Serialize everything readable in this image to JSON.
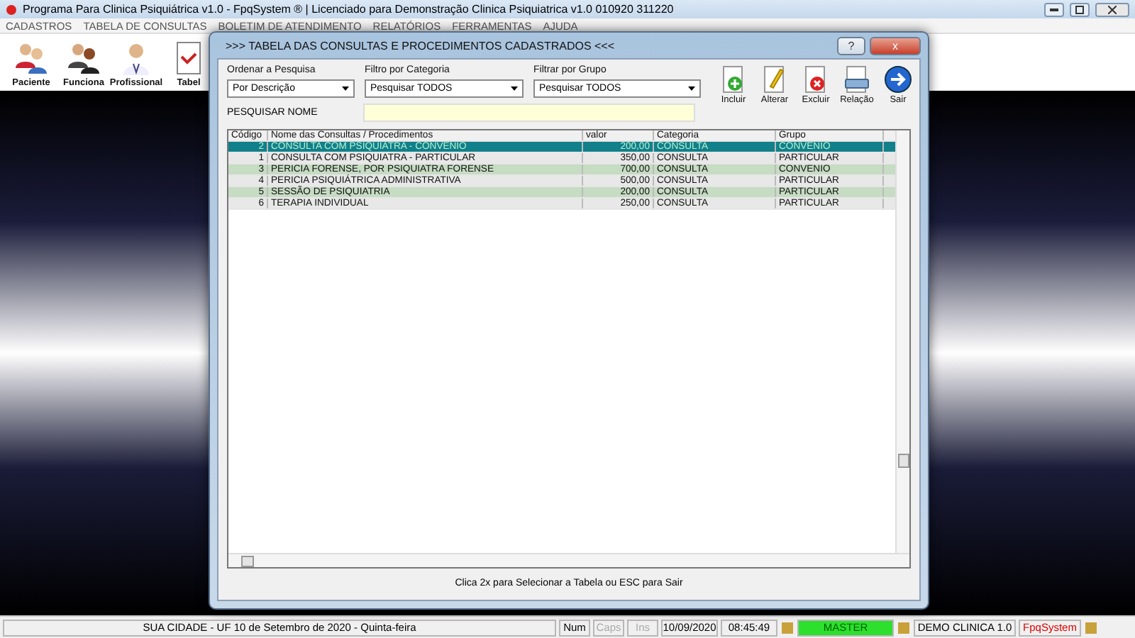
{
  "window": {
    "title": "Programa Para Clinica Psiquiátrica v1.0 - FpqSystem ® | Licenciado para  Demonstração Clinica Psiquiatrica v1.0 010920 311220"
  },
  "menu": [
    "CADASTROS",
    "TABELA DE CONSULTAS",
    "BOLETIM DE ATENDIMENTO",
    "RELATÓRIOS",
    "FERRAMENTAS",
    "AJUDA"
  ],
  "toolbar": [
    {
      "label": "Paciente",
      "kind": "family"
    },
    {
      "label": "Funciona",
      "kind": "couple"
    },
    {
      "label": "Profissional",
      "kind": "doctor"
    },
    {
      "label": "Tabel",
      "kind": "table"
    }
  ],
  "dialog": {
    "title": ">>>  TABELA DAS CONSULTAS E PROCEDIMENTOS CADASTRADOS  <<<",
    "help": "?",
    "close": "x",
    "filters": [
      {
        "label": "Ordenar a Pesquisa",
        "value": "Por Descrição"
      },
      {
        "label": "Filtro por Categoria",
        "value": "Pesquisar TODOS"
      },
      {
        "label": "Filtrar por Grupo",
        "value": "Pesquisar TODOS"
      }
    ],
    "actions": [
      {
        "label": "Incluir",
        "kind": "add"
      },
      {
        "label": "Alterar",
        "kind": "edit"
      },
      {
        "label": "Excluir",
        "kind": "delete"
      },
      {
        "label": "Relação",
        "kind": "print"
      },
      {
        "label": "Sair",
        "kind": "exit"
      }
    ],
    "search": {
      "label": "PESQUISAR NOME"
    },
    "table": {
      "columns": [
        "Código",
        "Nome das Consultas / Procedimentos",
        "valor",
        "Categoria",
        "Grupo"
      ],
      "rows": [
        {
          "cells": [
            "2",
            "CONSULTA COM PSIQUIATRA - CONVENIO",
            "200,00",
            "CONSULTA",
            "CONVENIO"
          ],
          "selected": true
        },
        {
          "cells": [
            "1",
            "CONSULTA COM PSIQUIATRA - PARTICULAR",
            "350,00",
            "CONSULTA",
            "PARTICULAR"
          ],
          "selected": false
        },
        {
          "cells": [
            "3",
            "PERICIA FORENSE, POR PSIQUIATRA FORENSE",
            "700,00",
            "CONSULTA",
            "CONVENIO"
          ],
          "selected": false
        },
        {
          "cells": [
            "4",
            "PERICIA PSIQUIÁTRICA ADMINISTRATIVA",
            "500,00",
            "CONSULTA",
            "PARTICULAR"
          ],
          "selected": false
        },
        {
          "cells": [
            "5",
            "SESSÃO DE PSIQUIATRIA",
            "200,00",
            "CONSULTA",
            "PARTICULAR"
          ],
          "selected": false
        },
        {
          "cells": [
            "6",
            "TERAPIA INDIVIDUAL",
            "250,00",
            "CONSULTA",
            "PARTICULAR"
          ],
          "selected": false
        }
      ]
    },
    "hint": "Clica 2x para Selecionar a Tabela ou ESC para Sair"
  },
  "status_bar": [
    {
      "text": "SUA CIDADE - UF 10 de Setembro de 2020 - Quinta-feira",
      "kind": "wide"
    },
    {
      "text": "Num",
      "kind": "key",
      "disabled": false
    },
    {
      "text": "Caps",
      "kind": "key",
      "disabled": true
    },
    {
      "text": "Ins",
      "kind": "key",
      "disabled": true
    },
    {
      "text": "10/09/2020",
      "kind": "plain"
    },
    {
      "text": "08:45:49",
      "kind": "plain"
    },
    {
      "text": "MASTER",
      "kind": "user"
    },
    {
      "text": "DEMO CLINICA 1.0",
      "kind": "db"
    },
    {
      "text": "FpqSystem",
      "kind": "brand"
    }
  ]
}
